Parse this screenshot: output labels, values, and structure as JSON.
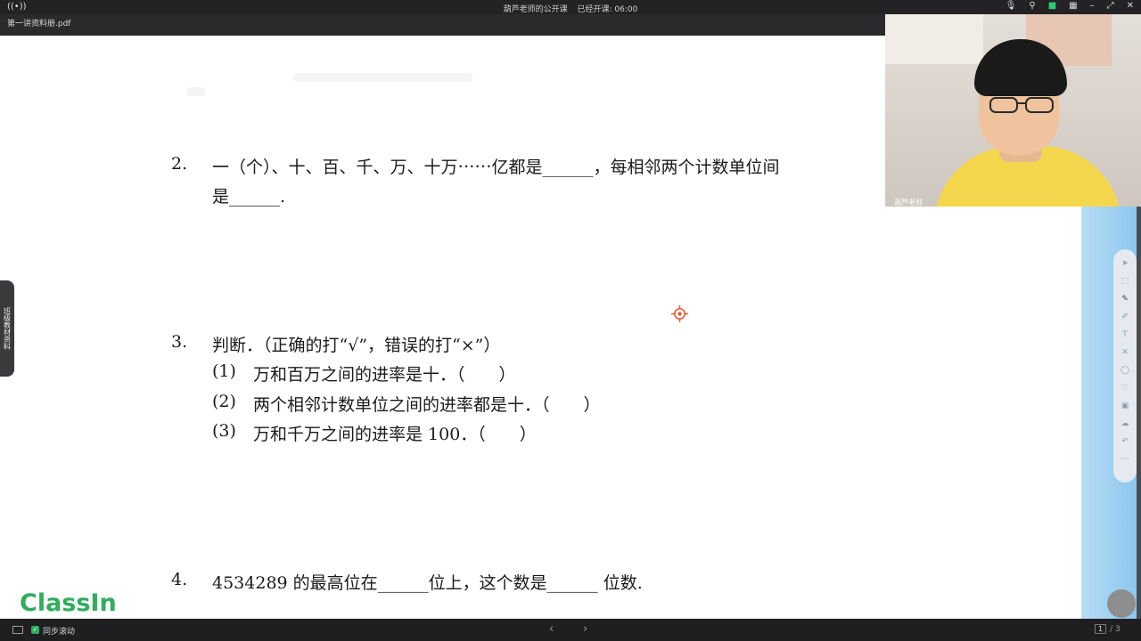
{
  "titlebar": {
    "meeting_title": "葫芦老师的公开课",
    "elapsed_label": "已经开课: 06:00"
  },
  "tab": {
    "filename": "第一讲资料册.pdf"
  },
  "document": {
    "q2": {
      "number": "2.",
      "line1": "一（个）、十、百、千、万、十万⋯⋯亿都是______，每相邻两个计数单位间",
      "line2": "是______."
    },
    "q3": {
      "number": "3.",
      "title": "判断．（正确的打“√”，错误的打“×”）",
      "items": [
        {
          "label": "(1)",
          "text": "万和百万之间的进率是十．（　　）"
        },
        {
          "label": "(2)",
          "text": "两个相邻计数单位之间的进率都是十．（　　）"
        },
        {
          "label": "(3)",
          "text": "万和千万之间的进率是 100．（　　）"
        }
      ]
    },
    "q4": {
      "number": "4.",
      "text": "4534289 的最高位在______位上，这个数是______ 位数."
    }
  },
  "webcam": {
    "name": "葫芦老师"
  },
  "drawer": {
    "label": "班级教材资料"
  },
  "logo": {
    "text": "ClassIn"
  },
  "bottombar": {
    "sync_label": "同步滚动",
    "prev": "‹",
    "next": "›",
    "current_page": "1",
    "total_pages": "/ 3"
  },
  "colors": {
    "accent": "#2fae5d",
    "scroll_blue": "#8cc7ef",
    "target": "#e8542c"
  }
}
